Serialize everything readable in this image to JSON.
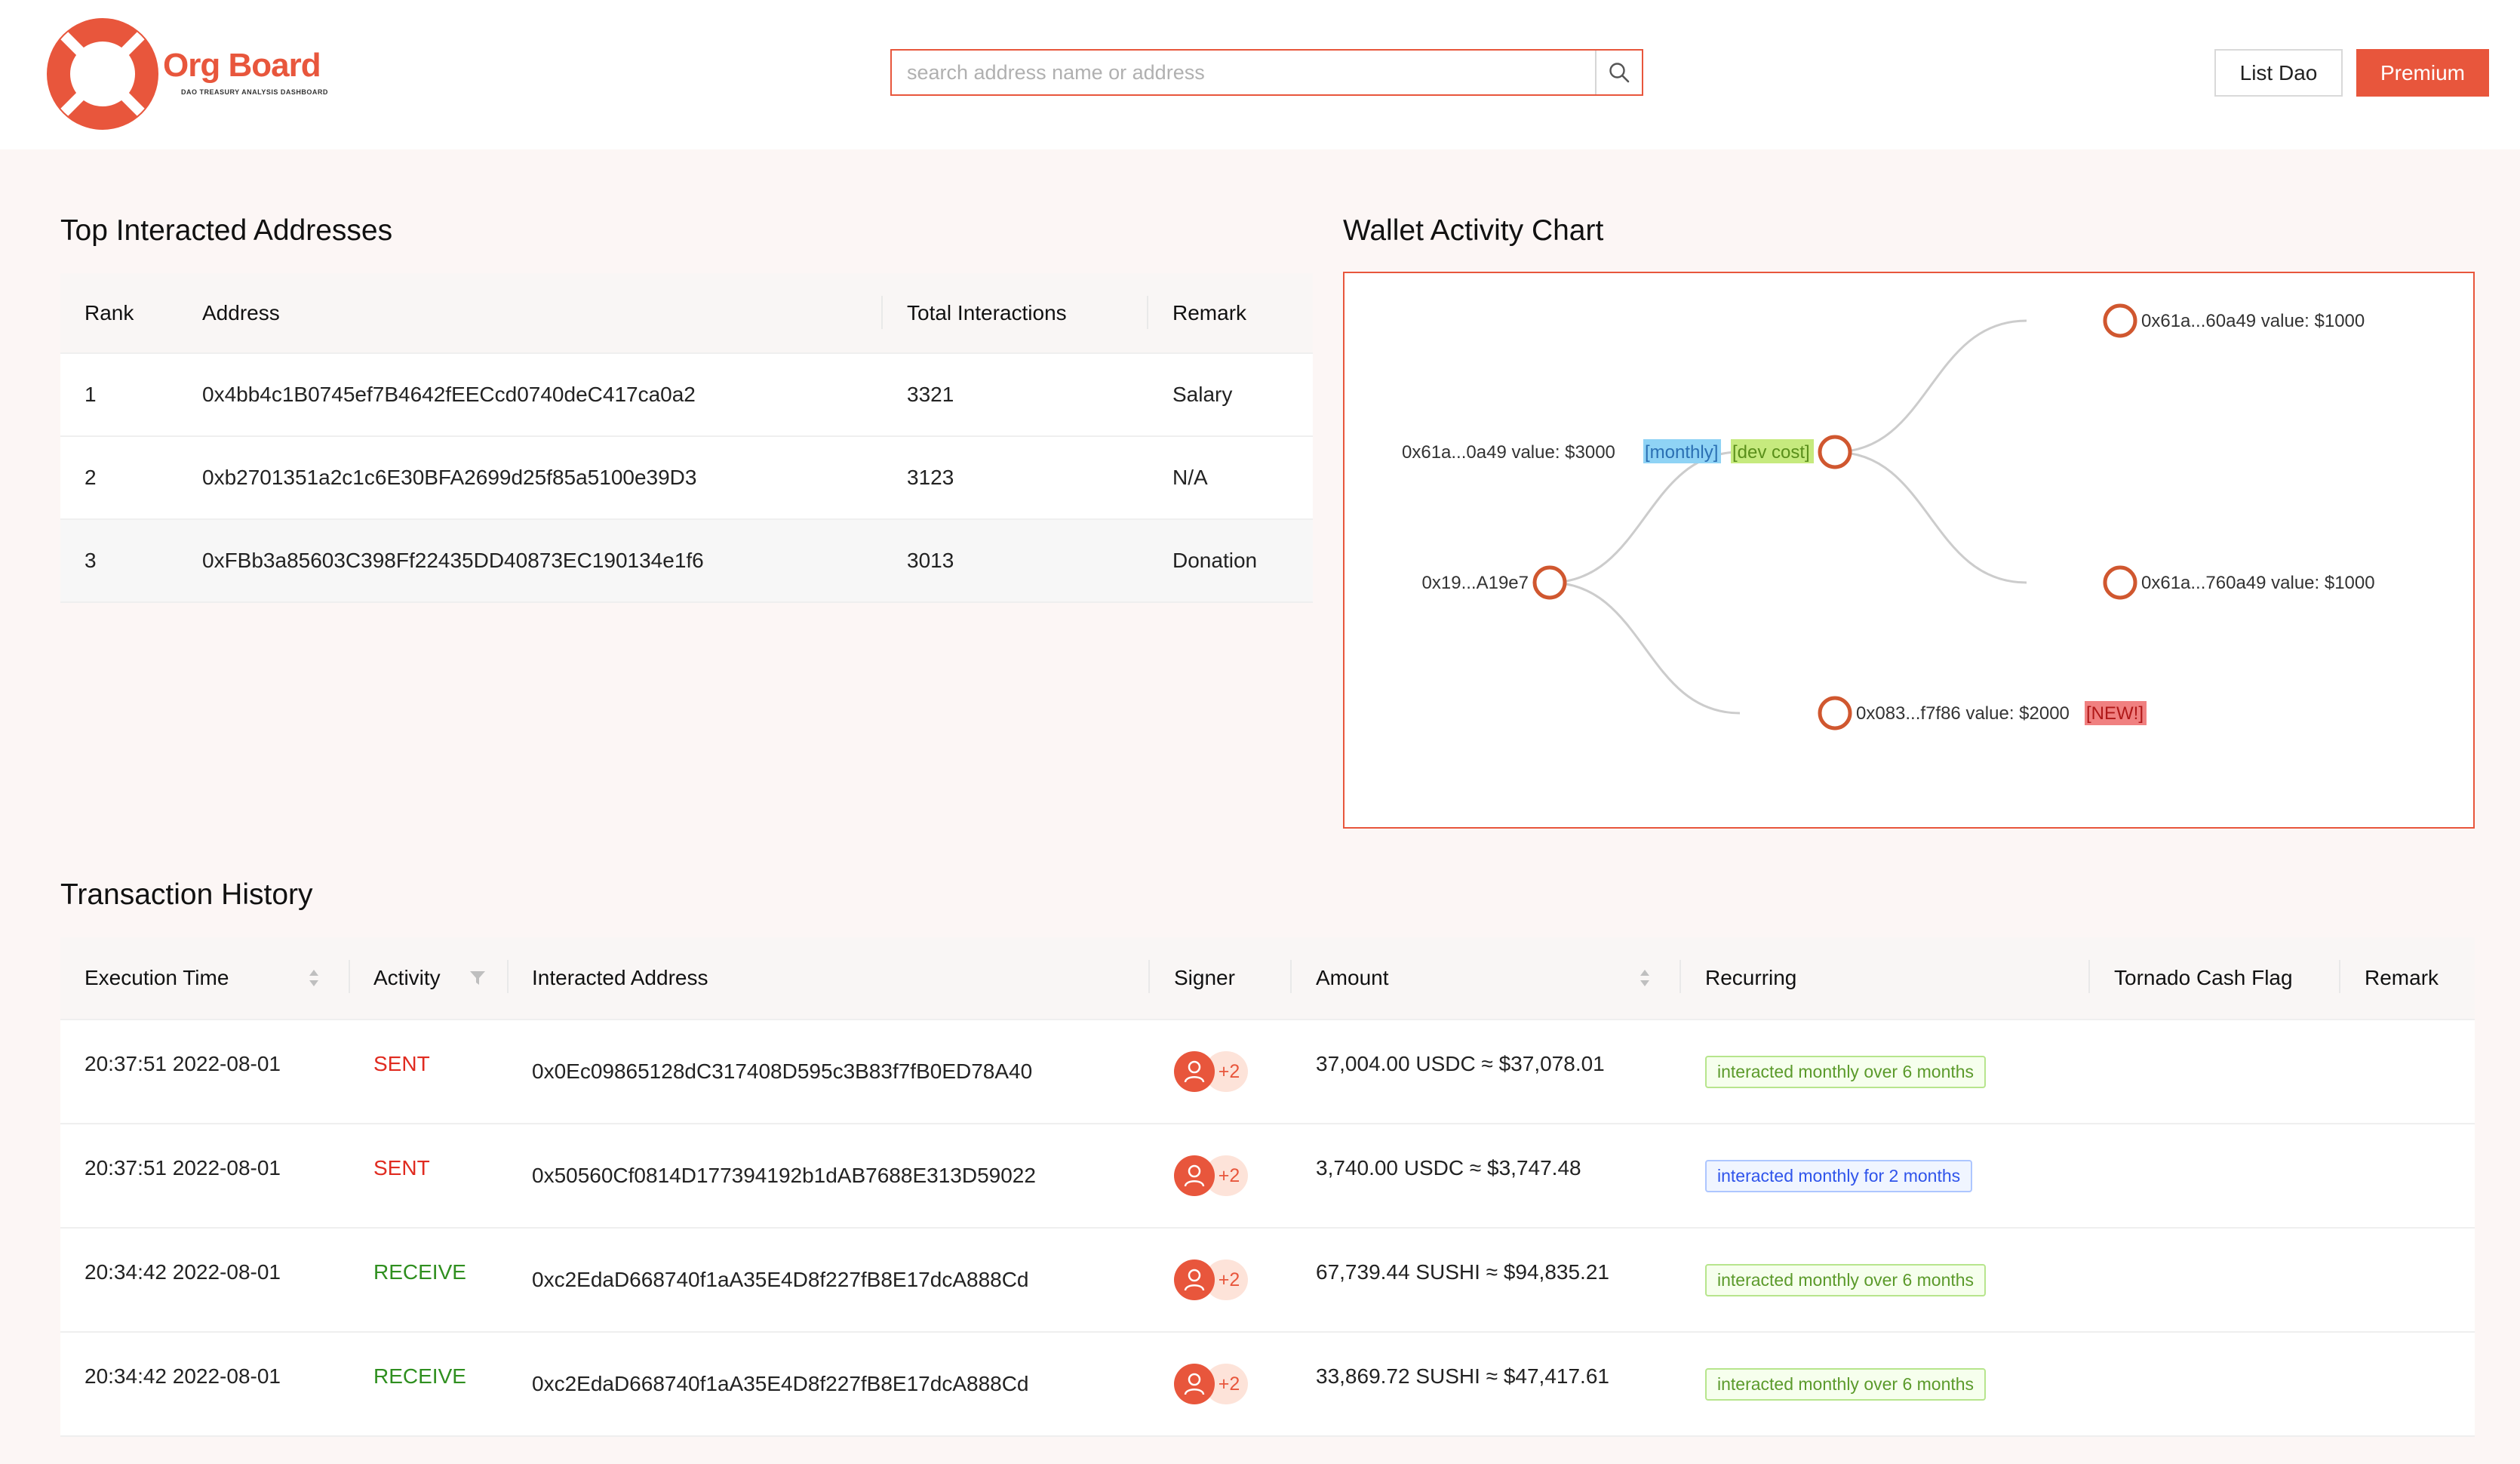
{
  "header": {
    "brand": "Org Board",
    "brand_sub": "DAO TREASURY ANALYSIS DASHBOARD",
    "search_placeholder": "search address name or address",
    "list_dao": "List Dao",
    "premium": "Premium",
    "accent_color": "#e8563c"
  },
  "top_addresses": {
    "title": "Top Interacted Addresses",
    "columns": [
      "Rank",
      "Address",
      "Total Interactions",
      "Remark"
    ],
    "rows": [
      {
        "rank": "1",
        "address": "0x4bb4c1B0745ef7B4642fEECcd0740deC417ca0a2",
        "interactions": "3321",
        "remark": "Salary"
      },
      {
        "rank": "2",
        "address": "0xb2701351a2c1c6E30BFA2699d25f85a5100e39D3",
        "interactions": "3123",
        "remark": "N/A"
      },
      {
        "rank": "3",
        "address": "0xFBb3a85603C398Ff22435DD40873EC190134e1f6",
        "interactions": "3013",
        "remark": "Donation"
      }
    ]
  },
  "chart": {
    "title": "Wallet Activity Chart",
    "nodes": [
      {
        "label": "0x19...A19e7"
      },
      {
        "label": "0x61a...0a49 value: $3000",
        "tags": [
          "[monthly]",
          "[dev cost]"
        ]
      },
      {
        "label": "0x083...f7f86 value: $2000",
        "tags": [
          "[NEW!]"
        ]
      },
      {
        "label": "0x61a...60a49 value: $1000"
      },
      {
        "label": "0x61a...760a49 value: $1000"
      }
    ]
  },
  "transactions": {
    "title": "Transaction History",
    "columns": [
      "Execution Time",
      "Activity",
      "Interacted Address",
      "Signer",
      "Amount",
      "Recurring",
      "Tornado Cash Flag",
      "Remark"
    ],
    "rows": [
      {
        "time": "20:37:51 2022-08-01",
        "activity": "SENT",
        "address": "0x0Ec09865128dC317408D595c3B83f7fB0ED78A40",
        "signer_extra": "+2",
        "amount": "37,004.00 USDC ≈ $37,078.01",
        "recurring": "interacted monthly over 6 months"
      },
      {
        "time": "20:37:51 2022-08-01",
        "activity": "SENT",
        "address": "0x50560Cf0814D177394192b1dAB7688E313D59022",
        "signer_extra": "+2",
        "amount": "3,740.00 USDC ≈ $3,747.48",
        "recurring": "interacted monthly for 2 months"
      },
      {
        "time": "20:34:42 2022-08-01",
        "activity": "RECEIVE",
        "address": "0xc2EdaD668740f1aA35E4D8f227fB8E17dcA888Cd",
        "signer_extra": "+2",
        "amount": "67,739.44 SUSHI ≈ $94,835.21",
        "recurring": "interacted monthly over 6 months"
      },
      {
        "time": "20:34:42 2022-08-01",
        "activity": "RECEIVE",
        "address": "0xc2EdaD668740f1aA35E4D8f227fB8E17dcA888Cd",
        "signer_extra": "+2",
        "amount": "33,869.72 SUSHI ≈ $47,417.61",
        "recurring": "interacted monthly over 6 months"
      }
    ]
  }
}
